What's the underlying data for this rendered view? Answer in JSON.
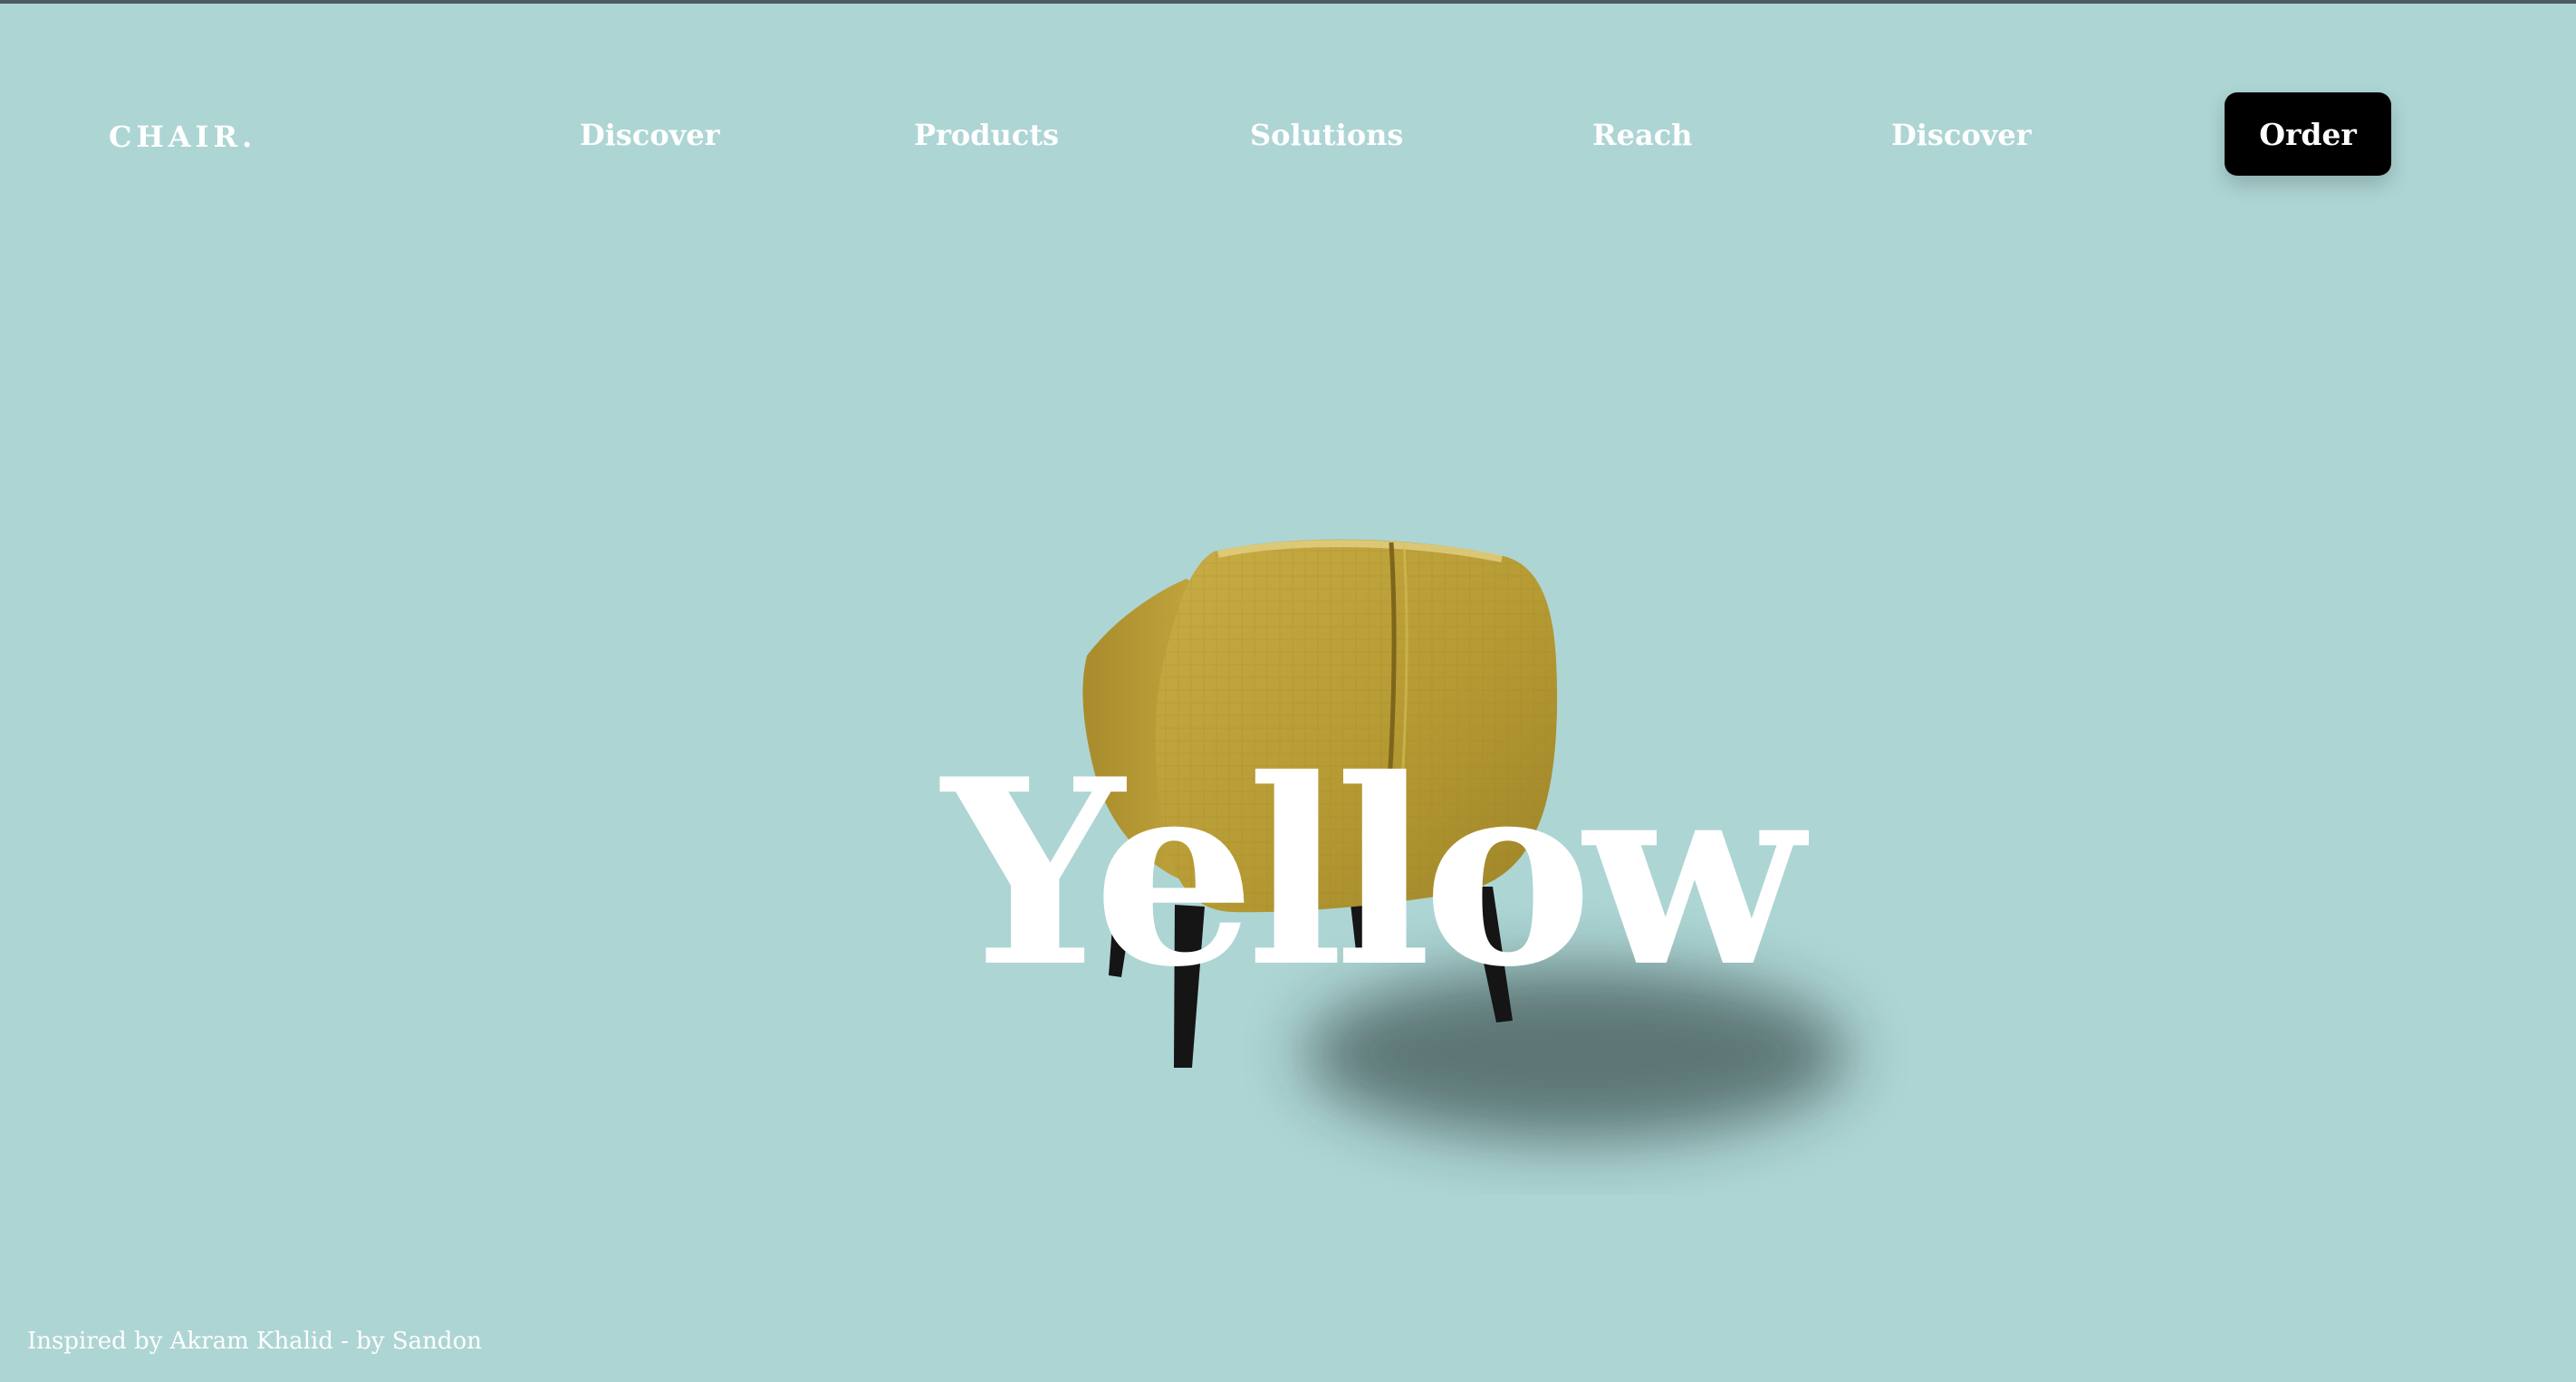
{
  "nav": {
    "logo": "CHAIR.",
    "links": [
      "Discover",
      "Products",
      "Solutions",
      "Reach",
      "Discover"
    ],
    "cta": "Order"
  },
  "hero": {
    "headline": "Yellow",
    "product_image": "yellow-armchair",
    "chair_color": "#b89a2f"
  },
  "footer": {
    "credit": "Inspired by Akram Khalid - by Sandon"
  },
  "colors": {
    "background": "#add5d4",
    "text": "#ffffff",
    "button": "#000000"
  }
}
